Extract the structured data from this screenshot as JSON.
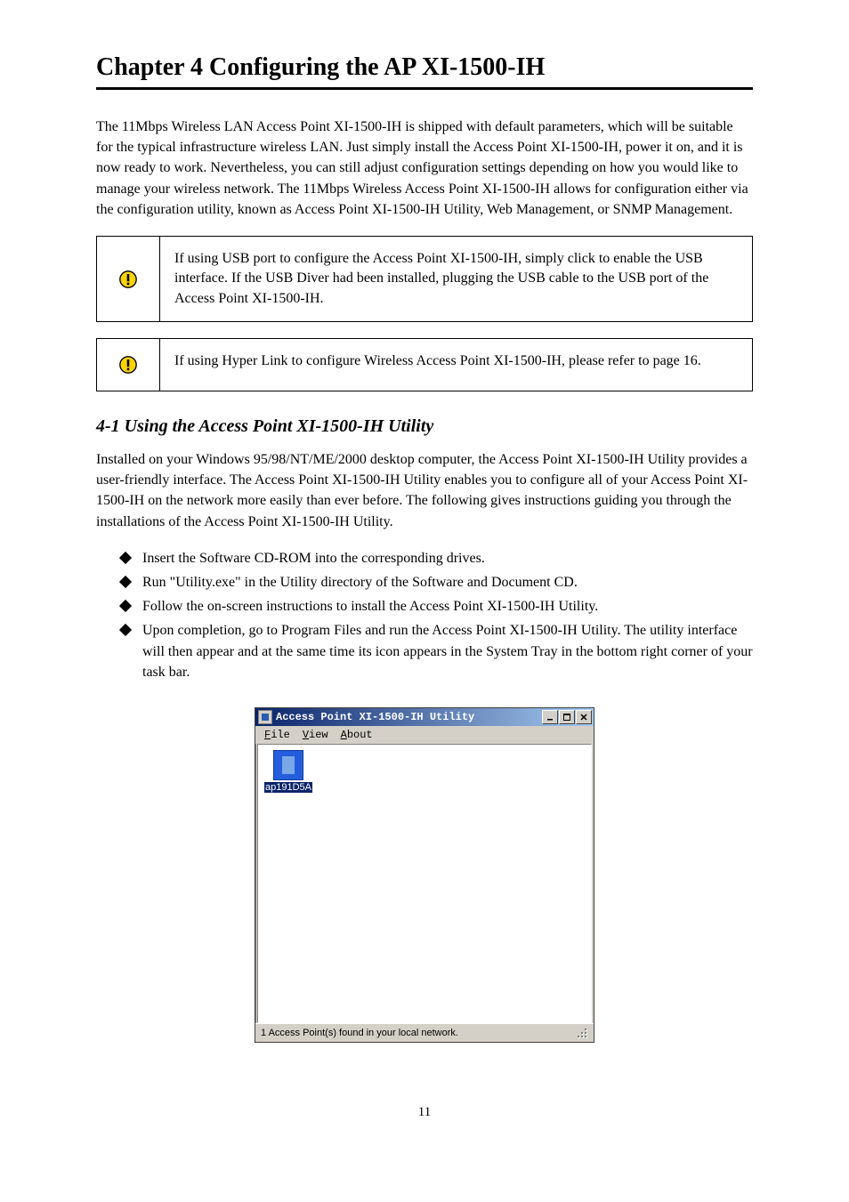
{
  "chapter_title": "Chapter 4  Configuring the AP XI-1500-IH",
  "intro_1": "The 11Mbps Wireless LAN Access Point XI-1500-IH is shipped with default parameters, which will be suitable for the typical infrastructure wireless LAN. Just simply install the Access Point XI-1500-IH, power it on, and it is now ready to work. Nevertheless, you can still adjust configuration settings depending on how you would like to manage your wireless network. The 11Mbps Wireless Access Point XI-1500-IH allows for configuration either via the configuration utility, known as Access Point XI-1500-IH Utility, Web Management, or SNMP Management.",
  "notes": [
    "If using USB port to configure the Access Point XI-1500-IH, simply click to enable the USB interface. If the USB Diver had been installed, plugging the USB cable to the USB port of the Access Point XI-1500-IH.",
    "If using Hyper Link to configure Wireless Access Point XI-1500-IH, please refer to page 16."
  ],
  "section_heading": "4-1 Using the Access Point XI-1500-IH Utility",
  "section_intro": "Installed on your Windows 95/98/NT/ME/2000 desktop computer, the Access Point XI-1500-IH Utility provides a user-friendly interface. The Access Point XI-1500-IH Utility enables you to configure all of your Access Point XI-1500-IH on the network more easily than ever before. The following gives instructions guiding you through the installations of the Access Point XI-1500-IH Utility.",
  "bullets": [
    "Insert the Software CD-ROM into the corresponding drives.",
    "Run \"Utility.exe\" in the Utility directory of the Software and Document CD.",
    "Follow the on-screen instructions to install the Access Point XI-1500-IH Utility.",
    "Upon completion, go to Program Files and run the Access Point XI-1500-IH Utility. The utility interface will then appear and at the same time its icon appears in the System Tray in the bottom right corner of your task bar."
  ],
  "window": {
    "title": "Access Point XI-1500-IH Utility",
    "menu": {
      "file": "File",
      "view": "View",
      "about": "About"
    },
    "item_label": "ap191D5A",
    "status": "1 Access Point(s) found in your local network."
  },
  "page_number": "11"
}
